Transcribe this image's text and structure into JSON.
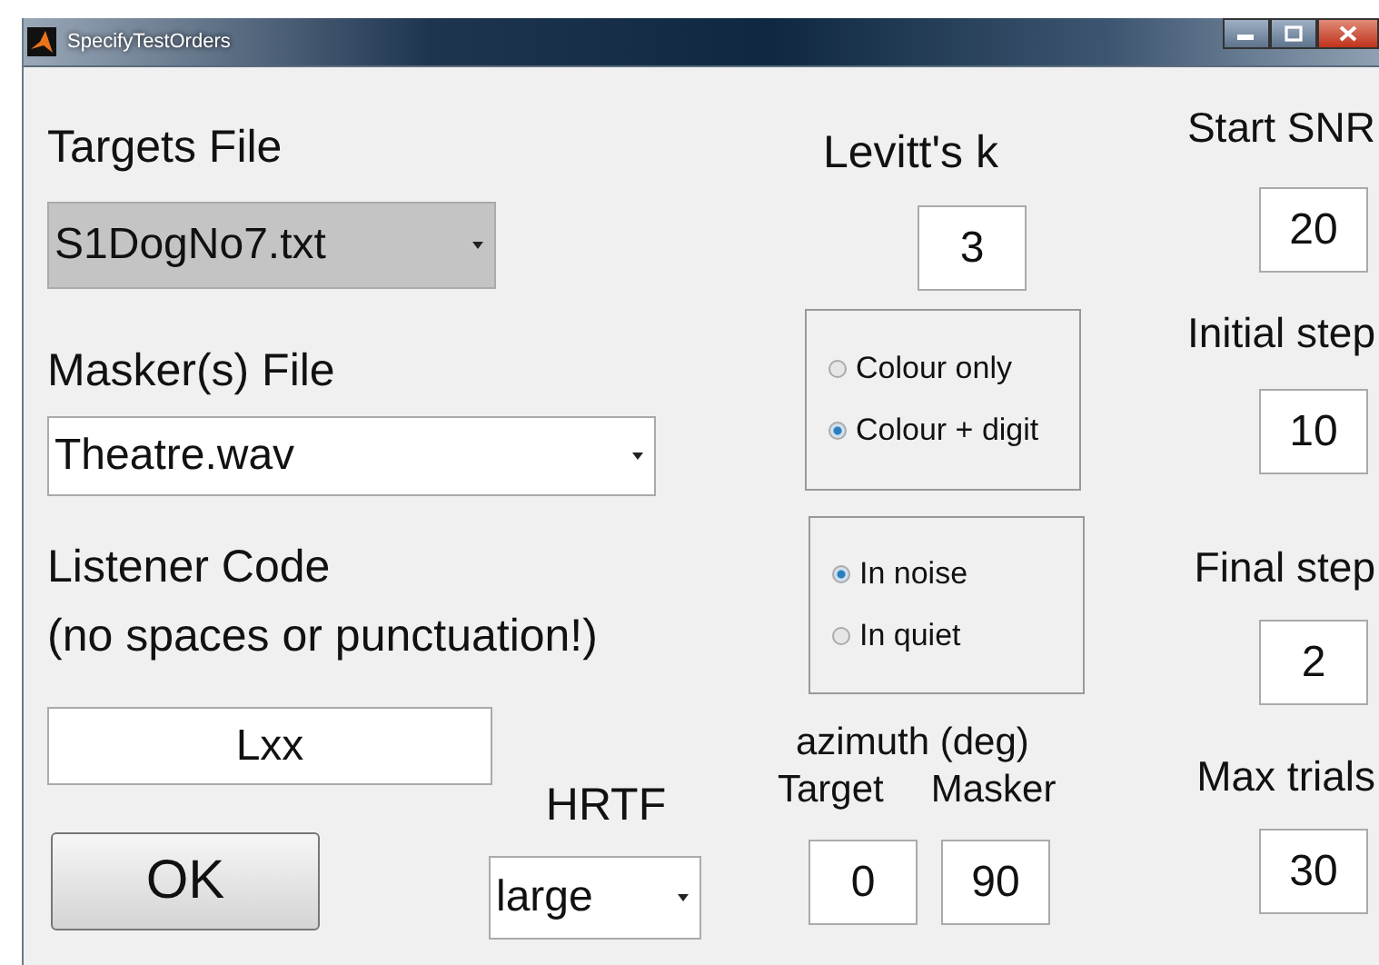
{
  "window": {
    "title": "SpecifyTestOrders"
  },
  "targets_file": {
    "label": "Targets File",
    "value": "S1DogNo7.txt",
    "highlighted": true
  },
  "masker_file": {
    "label": "Masker(s) File",
    "value": "Theatre.wav",
    "highlighted": false
  },
  "listener": {
    "label": "Listener Code",
    "hint": "(no spaces or punctuation!)",
    "value": "Lxx"
  },
  "ok_button": "OK",
  "hrtf": {
    "label": "HRTF",
    "value": "large"
  },
  "levitt": {
    "label": "Levitt's k",
    "value": "3"
  },
  "stimulus_options": [
    {
      "label": "Colour only",
      "selected": false
    },
    {
      "label": "Colour + digit",
      "selected": true
    }
  ],
  "noise_options": [
    {
      "label": "In noise",
      "selected": true
    },
    {
      "label": "In quiet",
      "selected": false
    }
  ],
  "azimuth": {
    "label": "azimuth (deg)",
    "target_label": "Target",
    "masker_label": "Masker",
    "target_value": "0",
    "masker_value": "90"
  },
  "start_snr": {
    "label": "Start SNR",
    "value": "20"
  },
  "initial_step": {
    "label": "Initial step",
    "value": "10"
  },
  "final_step": {
    "label": "Final step",
    "value": "2"
  },
  "max_trials": {
    "label": "Max trials",
    "value": "30"
  }
}
